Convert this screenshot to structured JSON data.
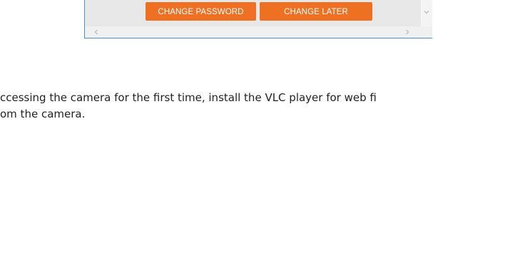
{
  "dialog": {
    "buttons": {
      "change_password": "CHANGE PASSWORD",
      "change_later": "CHANGE LATER"
    },
    "icons": {
      "scroll_down": "chevron-down-icon",
      "scroll_left": "chevron-left-icon",
      "scroll_right": "chevron-right-icon"
    },
    "colors": {
      "button_bg": "#ee7022",
      "frame_border": "#4a90c8"
    }
  },
  "document": {
    "lines": [
      "ccessing the camera for the first time, install the VLC player for web fi",
      "om the camera."
    ]
  }
}
